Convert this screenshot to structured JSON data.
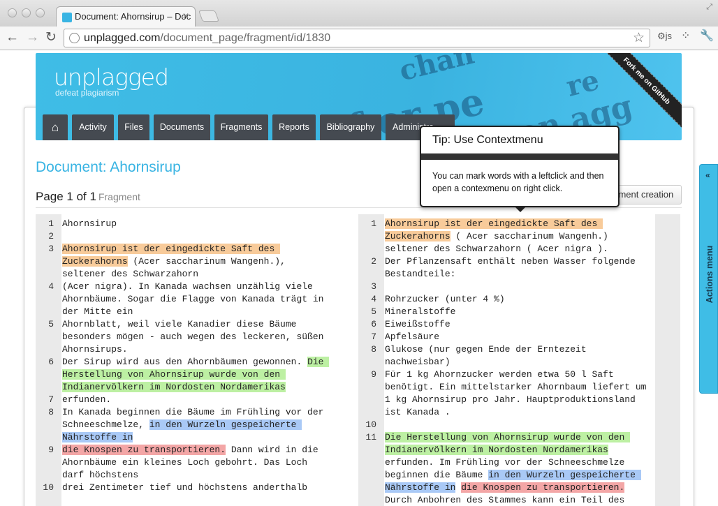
{
  "browser": {
    "tab_title": "Document: Ahornsirup – Doc",
    "url_host": "unplagged.com",
    "url_path": "/document_page/fragment/id/1830"
  },
  "site": {
    "logo": "unplagged",
    "slogan": "defeat plagiarism",
    "ribbon": "Fork me on GitHub",
    "nav": [
      {
        "label": ""
      },
      {
        "label": "Activity"
      },
      {
        "label": "Files"
      },
      {
        "label": "Documents"
      },
      {
        "label": "Fragments"
      },
      {
        "label": "Reports"
      },
      {
        "label": "Bibliography"
      },
      {
        "label": "Administra"
      }
    ]
  },
  "main": {
    "title": "Document: Ahornsirup",
    "page_label": "Page 1 of 1",
    "page_sub": "Fragment",
    "fragment_button": "agment creation"
  },
  "tooltip": {
    "title": "Tip: Use Contextmenu",
    "body": "You can mark words with a leftclick and then open a contexmenu on right click."
  },
  "actions_menu": "Actions menu",
  "colors": {
    "accent": "#39b4e3",
    "orange": "#f8cb9a",
    "green": "#bdf0a3",
    "blue": "#a9c9f6",
    "red": "#f3a6a6"
  },
  "left_pane": [
    {
      "n": "1",
      "segs": [
        {
          "t": "Ahornsirup",
          "c": ""
        }
      ]
    },
    {
      "n": "2",
      "segs": []
    },
    {
      "n": "3",
      "segs": [
        {
          "t": "Ahornsirup ist der eingedickte Saft des Zuckerahorns",
          "c": "or"
        },
        {
          "t": " (Acer saccharinum Wangenh.), seltener des Schwarzahorn",
          "c": ""
        }
      ]
    },
    {
      "n": "4",
      "segs": [
        {
          "t": "(Acer nigra). In Kanada wachsen unzählig viele Ahornbäume. Sogar die Flagge von Kanada trägt in der Mitte ein",
          "c": ""
        }
      ]
    },
    {
      "n": "5",
      "segs": [
        {
          "t": "Ahornblatt, weil viele Kanadier diese Bäume besonders mögen - auch wegen des leckeren, süßen Ahornsirups.",
          "c": ""
        }
      ]
    },
    {
      "n": "6",
      "segs": [
        {
          "t": "Der Sirup wird aus den Ahornbäumen gewonnen. ",
          "c": ""
        },
        {
          "t": "Die Herstellung von Ahornsirup wurde von den Indianervölkern im Nordosten Nordamerikas",
          "c": "gr"
        },
        {
          "t": " erfunden.",
          "c": ""
        }
      ]
    },
    {
      "n": "7",
      "segs": []
    },
    {
      "n": "8",
      "segs": [
        {
          "t": "In Kanada beginnen die Bäume im Frühling vor der Schneeschmelze, ",
          "c": ""
        },
        {
          "t": "in den Wurzeln gespeicherte Nährstoffe in",
          "c": "bl"
        }
      ]
    },
    {
      "n": "9",
      "segs": [
        {
          "t": "die Knospen zu transportieren.",
          "c": "rd"
        },
        {
          "t": " Dann wird in die Ahornbäume ein kleines Loch gebohrt. Das Loch darf höchstens",
          "c": ""
        }
      ]
    },
    {
      "n": "10",
      "segs": [
        {
          "t": "drei Zentimeter tief und höchstens anderthalb",
          "c": ""
        }
      ]
    }
  ],
  "right_pane": [
    {
      "n": "1",
      "segs": [
        {
          "t": "Ahornsirup ist der eingedickte Saft des Zuckerahorns",
          "c": "or"
        },
        {
          "t": " ( Acer saccharinum Wangenh.) seltener des Schwarzahorn ( Acer nigra ).",
          "c": ""
        }
      ]
    },
    {
      "n": "2",
      "segs": [
        {
          "t": "Der Pflanzensaft enthält neben Wasser folgende Bestandteile:",
          "c": ""
        }
      ]
    },
    {
      "n": "3",
      "segs": []
    },
    {
      "n": "4",
      "segs": [
        {
          "t": "Rohrzucker (unter 4 %)",
          "c": ""
        }
      ]
    },
    {
      "n": "5",
      "segs": [
        {
          "t": "Mineralstoffe",
          "c": ""
        }
      ]
    },
    {
      "n": "6",
      "segs": [
        {
          "t": "Eiweißstoffe",
          "c": ""
        }
      ]
    },
    {
      "n": "7",
      "segs": [
        {
          "t": "Apfelsäure",
          "c": ""
        }
      ]
    },
    {
      "n": "8",
      "segs": [
        {
          "t": "Glukose (nur gegen Ende der Erntezeit nachweisbar)",
          "c": ""
        }
      ]
    },
    {
      "n": "9",
      "segs": [
        {
          "t": "Für 1 kg Ahornzucker werden etwa 50 l Saft benötigt. Ein mittelstarker Ahornbaum liefert um 1 kg Ahornsirup pro Jahr. Hauptproduktionsland ist Kanada .",
          "c": ""
        }
      ]
    },
    {
      "n": "10",
      "segs": []
    },
    {
      "n": "11",
      "segs": [
        {
          "t": "Die Herstellung von Ahornsirup wurde von den Indianervölkern im Nordosten Nordamerikas",
          "c": "gr"
        },
        {
          "t": " erfunden. Im Frühling vor der Schneeschmelze beginnen die Bäume ",
          "c": ""
        },
        {
          "t": "in den Wurzeln gespeicherte Nährstoffe in",
          "c": "bl"
        },
        {
          "t": " ",
          "c": ""
        },
        {
          "t": "die Knospen zu transportieren.",
          "c": "rd"
        },
        {
          "t": " Durch Anbohren des Stammes kann ein Teil des",
          "c": ""
        }
      ]
    }
  ]
}
